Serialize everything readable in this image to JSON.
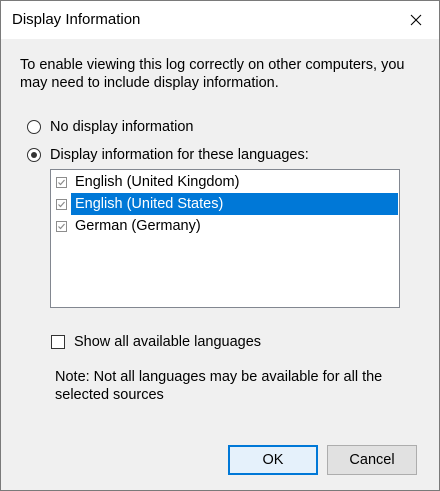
{
  "window": {
    "title": "Display Information",
    "close_icon": "close-icon"
  },
  "intro_text": "To enable viewing this log correctly on other computers, you may need to include display information.",
  "options": {
    "no_display": {
      "label": "No display information",
      "selected": false
    },
    "display_languages": {
      "label": "Display information for these languages:",
      "selected": true
    }
  },
  "languages": [
    {
      "label": "English (United Kingdom)",
      "checked": true,
      "highlighted": false
    },
    {
      "label": "English (United States)",
      "checked": true,
      "highlighted": true
    },
    {
      "label": "German (Germany)",
      "checked": true,
      "highlighted": false
    }
  ],
  "show_all": {
    "label": "Show all available languages",
    "checked": false
  },
  "note_text": "Note: Not all languages may be available for all the selected sources",
  "buttons": {
    "ok": "OK",
    "cancel": "Cancel"
  },
  "colors": {
    "selection": "#0078d7",
    "default_button_border": "#0078d7"
  }
}
